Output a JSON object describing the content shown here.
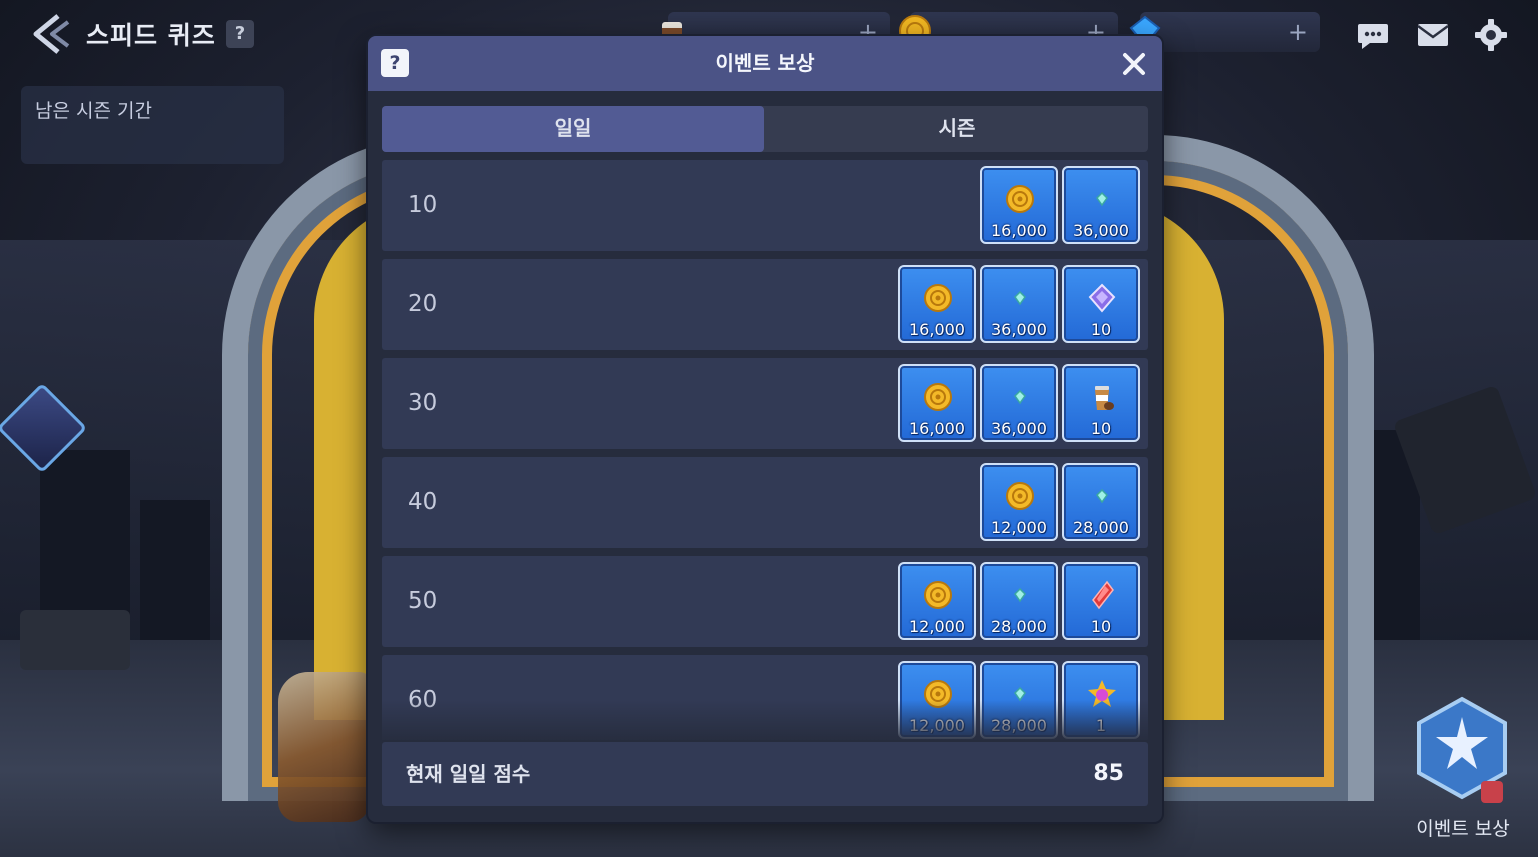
{
  "header": {
    "title": "스피드 퀴즈",
    "help": "?",
    "season_label": "남은 시즌 기간"
  },
  "currencies": [
    {
      "name": "coffee-icon",
      "plus": "+"
    },
    {
      "name": "coin-icon",
      "plus": "+"
    },
    {
      "name": "diamond-icon",
      "plus": "+"
    }
  ],
  "dialog": {
    "help": "?",
    "title": "이벤트 보상",
    "tabs": [
      {
        "label": "일일",
        "active": true
      },
      {
        "label": "시즌",
        "active": false
      }
    ],
    "rows": [
      {
        "level": "10",
        "rewards": [
          {
            "icon": "coin-icon",
            "amount": "16,000"
          },
          {
            "icon": "crystal-icon",
            "amount": "36,000"
          }
        ]
      },
      {
        "level": "20",
        "rewards": [
          {
            "icon": "coin-icon",
            "amount": "16,000"
          },
          {
            "icon": "crystal-icon",
            "amount": "36,000"
          },
          {
            "icon": "purple-gem-icon",
            "amount": "10"
          }
        ]
      },
      {
        "level": "30",
        "rewards": [
          {
            "icon": "coin-icon",
            "amount": "16,000"
          },
          {
            "icon": "crystal-icon",
            "amount": "36,000"
          },
          {
            "icon": "coffee-cup-icon",
            "amount": "10"
          }
        ]
      },
      {
        "level": "40",
        "rewards": [
          {
            "icon": "coin-icon",
            "amount": "12,000"
          },
          {
            "icon": "crystal-icon",
            "amount": "28,000"
          }
        ]
      },
      {
        "level": "50",
        "rewards": [
          {
            "icon": "coin-icon",
            "amount": "12,000"
          },
          {
            "icon": "crystal-icon",
            "amount": "28,000"
          },
          {
            "icon": "red-gem-icon",
            "amount": "10"
          }
        ]
      },
      {
        "level": "60",
        "rewards": [
          {
            "icon": "coin-icon",
            "amount": "12,000"
          },
          {
            "icon": "crystal-icon",
            "amount": "28,000"
          },
          {
            "icon": "star-badge-icon",
            "amount": "1"
          }
        ]
      }
    ],
    "footer": {
      "label": "현재 일일 점수",
      "value": "85"
    }
  },
  "side_button": {
    "label": "이벤트 보상"
  },
  "colors": {
    "header": "#4b5386",
    "tab_active": "#525b94",
    "row": "#323a55",
    "item": "#2a74de"
  }
}
